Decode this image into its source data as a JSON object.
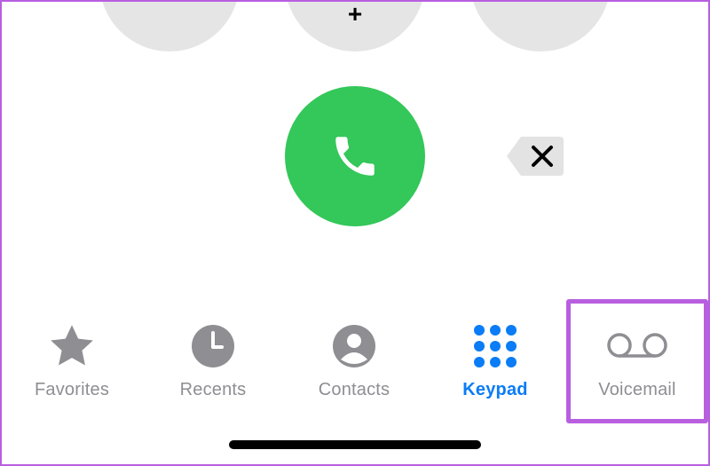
{
  "keypad": {
    "plus_key": "+"
  },
  "tab_bar": {
    "tabs": [
      {
        "label": "Favorites",
        "icon": "star-icon",
        "active": false
      },
      {
        "label": "Recents",
        "icon": "clock-icon",
        "active": false
      },
      {
        "label": "Contacts",
        "icon": "person-icon",
        "active": false
      },
      {
        "label": "Keypad",
        "icon": "keypad-icon",
        "active": true
      },
      {
        "label": "Voicemail",
        "icon": "voicemail-icon",
        "active": false
      }
    ]
  },
  "colors": {
    "call_green": "#34c759",
    "active_blue": "#0a7cf6",
    "inactive_gray": "#8e8e93",
    "highlight_purple": "#b85fe0"
  }
}
